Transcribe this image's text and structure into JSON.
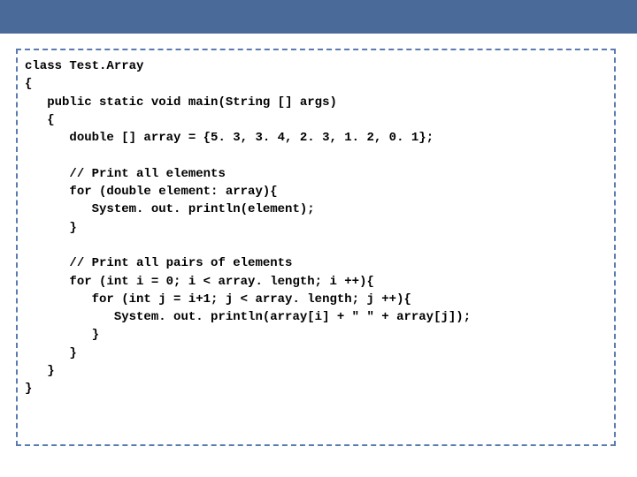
{
  "code": {
    "lines": [
      "class Test.Array",
      "{",
      "   public static void main(String [] args)",
      "   {",
      "      double [] array = {5. 3, 3. 4, 2. 3, 1. 2, 0. 1};",
      "",
      "      // Print all elements",
      "      for (double element: array){",
      "         System. out. println(element);",
      "      }",
      "",
      "      // Print all pairs of elements",
      "      for (int i = 0; i < array. length; i ++){",
      "         for (int j = i+1; j < array. length; j ++){",
      "            System. out. println(array[i] + \" \" + array[j]);",
      "         }",
      "      }",
      "   }",
      "}"
    ]
  },
  "colors": {
    "bar": "#4a6a9a",
    "border": "#5a7bae"
  }
}
